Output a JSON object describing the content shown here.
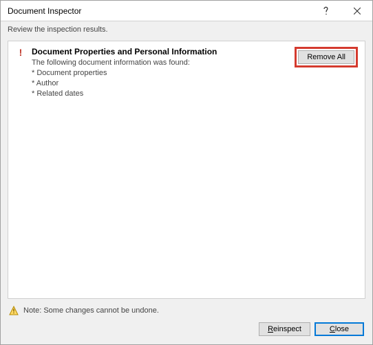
{
  "titlebar": {
    "title": "Document Inspector"
  },
  "subheader": "Review the inspection results.",
  "result": {
    "icon": "!",
    "heading": "Document Properties and Personal Information",
    "intro": "The following document information was found:",
    "items": [
      "* Document properties",
      "* Author",
      "* Related dates"
    ],
    "remove_label": "Remove All"
  },
  "footer": {
    "note": "Note: Some changes cannot be undone.",
    "reinspect_label": "Reinspect",
    "close_label": "Close"
  }
}
